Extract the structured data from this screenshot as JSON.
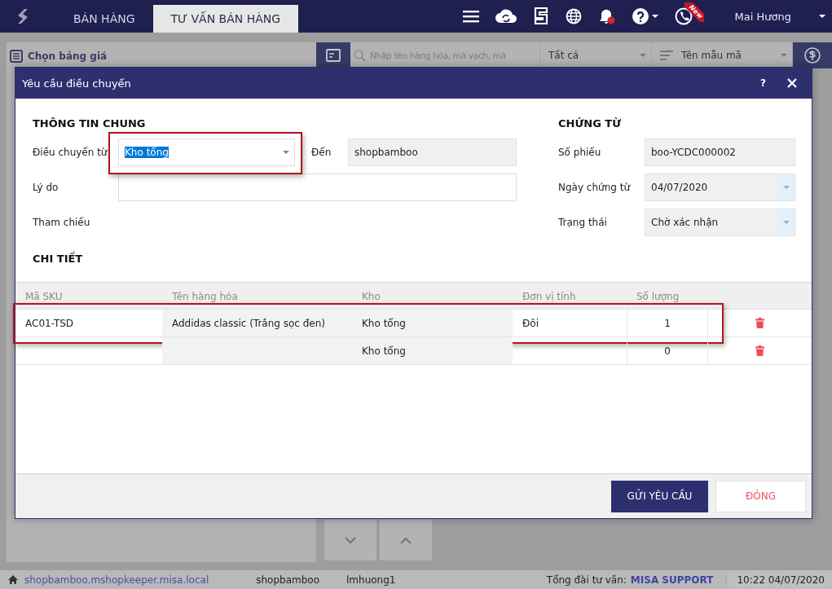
{
  "top_bar": {
    "tabs": [
      {
        "label": "BÁN HÀNG",
        "selected": false
      },
      {
        "label": "TƯ VẤN BÁN HÀNG",
        "selected": true
      }
    ],
    "notification_dot": true,
    "new_badge": "New",
    "user": "Mai Hương"
  },
  "background": {
    "price_list": "Chọn bảng giá",
    "search": {
      "placeholder": "Nhập tên hàng hóa, mã vạch, mã"
    },
    "filter": "Tất cả",
    "sort": "Tên mẫu mã"
  },
  "dialog": {
    "title": "Yêu cầu điều chuyển",
    "help": "?",
    "general": {
      "heading": "THÔNG TIN CHUNG",
      "from_label": "Điều chuyển từ",
      "from_value": "Kho tổng",
      "from_text_selected": true,
      "from_highlighted": true,
      "to_label": "Đến",
      "to_value": "shopbamboo",
      "reason_label": "Lý do",
      "reference_label": "Tham chiếu"
    },
    "document": {
      "heading": "CHỨNG TỪ",
      "fields": [
        {
          "label": "Số phiếu",
          "value": "boo-YCDC000002",
          "kind": "readonly"
        },
        {
          "label": "Ngày chứng từ",
          "value": "04/07/2020",
          "kind": "dropdown"
        },
        {
          "label": "Trạng thái",
          "value": "Chờ xác nhận",
          "kind": "dropdown"
        }
      ]
    },
    "details_heading": "CHI TIẾT",
    "table": {
      "columns": [
        "Mã SKU",
        "Tên hàng hóa",
        "Kho",
        "Đơn vị tính",
        "Số lượng"
      ],
      "rows": [
        {
          "sku": "AC01-TSD",
          "name": "Addidas classic (Trắng sọc đen)",
          "warehouse": "Kho tổng",
          "unit": "Đôi",
          "quantity": "1",
          "highlighted": true
        },
        {
          "warehouse": "Kho tổng",
          "quantity": "0",
          "highlighted": false
        }
      ]
    },
    "buttons": [
      {
        "label": "GỬI YÊU CẦU",
        "kind": "primary"
      },
      {
        "label": "ĐÓNG",
        "kind": "secondary"
      }
    ]
  },
  "status_bar": {
    "host": "shopbamboo.mshopkeeper.misa.local",
    "shop": "shopbamboo",
    "user": "lmhuong1",
    "hotline_label": "Tổng đài tư vấn:",
    "hotline": "MISA SUPPORT",
    "time": "10:22 04/07/2020"
  }
}
